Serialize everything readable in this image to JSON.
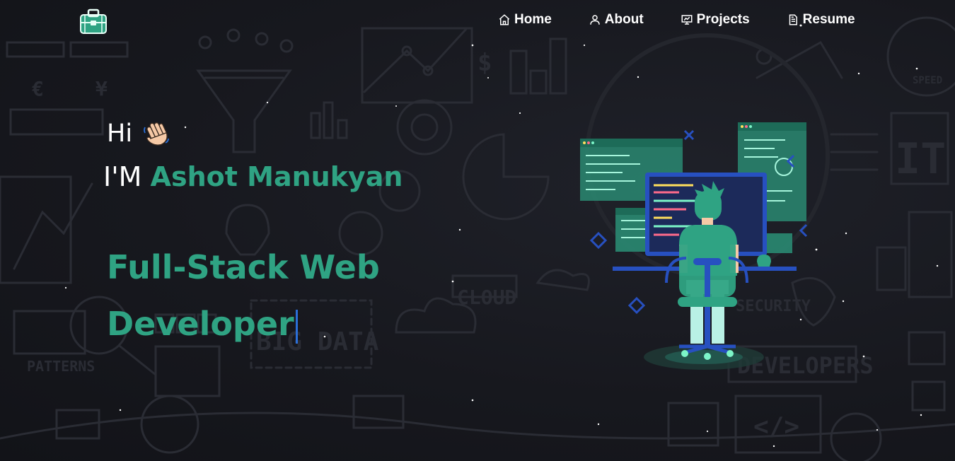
{
  "nav": {
    "items": [
      {
        "label": "Home",
        "icon": "home-icon"
      },
      {
        "label": "About",
        "icon": "user-icon"
      },
      {
        "label": "Projects",
        "icon": "presentation-icon"
      },
      {
        "label": "Resume",
        "icon": "document-icon"
      }
    ]
  },
  "hero": {
    "greeting": "Hi",
    "intro_prefix": "I'M",
    "name": "Ashot Manukyan",
    "role_line1": "Full-Stack Web",
    "role_line2": "Developer"
  },
  "background_labels": {
    "cloud": "CLOUD",
    "big_data": "BIG DATA",
    "patterns": "PATTERNS",
    "developers": "DEVELOPERS",
    "security": "SECURITY",
    "it": "IT",
    "speed": "SPEED",
    "code": "</>"
  },
  "colors": {
    "accent": "#2fa383",
    "background": "#17181e",
    "text": "#ffffff",
    "cursor": "#2b6fd8"
  }
}
